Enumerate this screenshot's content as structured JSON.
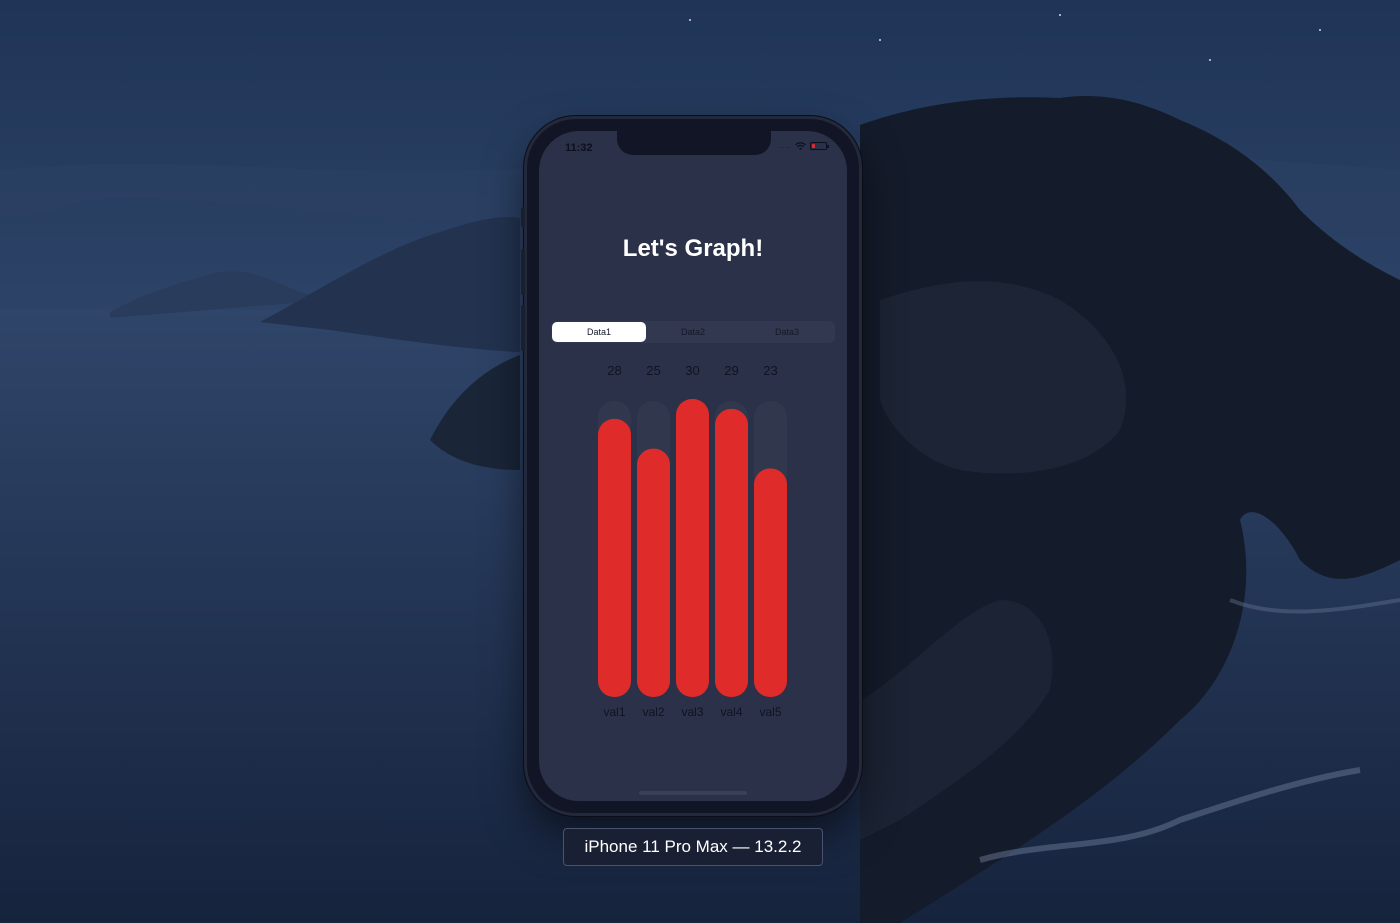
{
  "status_bar": {
    "time": "11:32",
    "signal": "....",
    "icons": [
      "wifi-icon",
      "battery-icon"
    ]
  },
  "app": {
    "title": "Let's Graph!",
    "tabs": [
      {
        "label": "Data1",
        "selected": true
      },
      {
        "label": "Data2",
        "selected": false
      },
      {
        "label": "Data3",
        "selected": false
      }
    ]
  },
  "chart_data": {
    "type": "bar",
    "categories": [
      "val1",
      "val2",
      "val3",
      "val4",
      "val5"
    ],
    "values": [
      28,
      25,
      30,
      29,
      23
    ],
    "ylim": [
      0,
      30
    ],
    "bar_color": "#e02b2b",
    "track_color": "#31374d",
    "value_label_color": "#0f1322",
    "category_label_color": "#0f1322"
  },
  "device_label": "iPhone 11 Pro Max — 13.2.2",
  "colors": {
    "screen_background": "#2b3148",
    "title": "#ffffff",
    "segmented_background": "#323850",
    "segment_selected": "#ffffff"
  }
}
